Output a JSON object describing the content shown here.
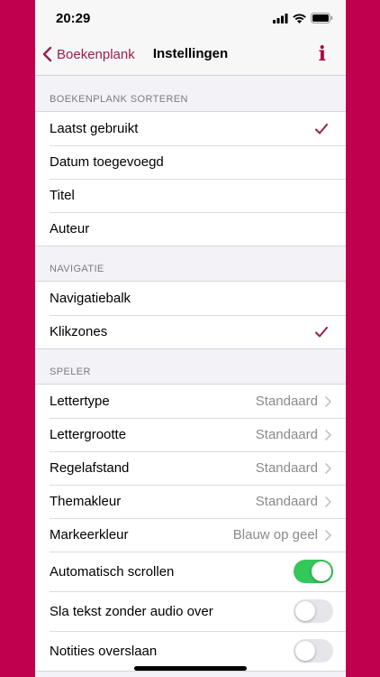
{
  "status": {
    "time": "20:29"
  },
  "nav": {
    "back_label": "Boekenplank",
    "title": "Instellingen",
    "info_label": "i"
  },
  "sections": {
    "sort": {
      "header": "BOEKENPLANK SORTEREN",
      "items": [
        {
          "label": "Laatst gebruikt",
          "checked": true
        },
        {
          "label": "Datum toegevoegd",
          "checked": false
        },
        {
          "label": "Titel",
          "checked": false
        },
        {
          "label": "Auteur",
          "checked": false
        }
      ]
    },
    "navigation": {
      "header": "NAVIGATIE",
      "items": [
        {
          "label": "Navigatiebalk",
          "checked": false
        },
        {
          "label": "Klikzones",
          "checked": true
        }
      ]
    },
    "player": {
      "header": "SPELER",
      "items": [
        {
          "label": "Lettertype",
          "value": "Standaard"
        },
        {
          "label": "Lettergrootte",
          "value": "Standaard"
        },
        {
          "label": "Regelafstand",
          "value": "Standaard"
        },
        {
          "label": "Themakleur",
          "value": "Standaard"
        },
        {
          "label": "Markeerkleur",
          "value": "Blauw op geel"
        }
      ],
      "toggles": [
        {
          "label": "Automatisch scrollen",
          "on": true
        },
        {
          "label": "Sla tekst zonder audio over",
          "on": false
        },
        {
          "label": "Notities overslaan",
          "on": false
        }
      ]
    }
  },
  "colors": {
    "accent": "#98204c",
    "background": "#c0004f",
    "toggle_on": "#34c759"
  }
}
